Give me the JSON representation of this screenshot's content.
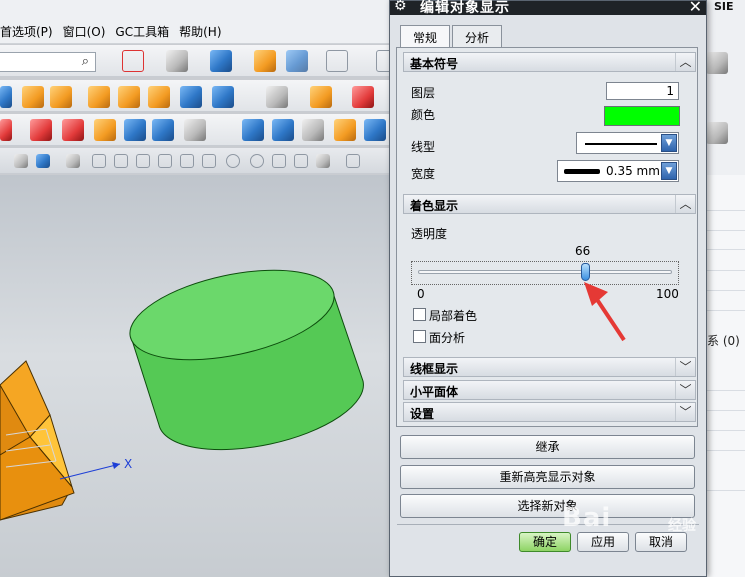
{
  "menubar": {
    "items": [
      "首选项(P)",
      "窗口(O)",
      "GC工具箱",
      "帮助(H)"
    ]
  },
  "app": {
    "brand_partial": "SIE",
    "right_panel_text": "系 (0)"
  },
  "viewport": {
    "axis_label": "X",
    "colors": {
      "cylinder": "#5ccf5c",
      "block": "#e8900e",
      "background": "#c9ced3"
    }
  },
  "dialog": {
    "title": "编辑对象显示",
    "tabs": [
      {
        "label": "常规",
        "active": true
      },
      {
        "label": "分析",
        "active": false
      }
    ],
    "sections": {
      "basic": {
        "title": "基本符号",
        "layer_label": "图层",
        "layer_value": "1",
        "color_label": "颜色",
        "color_value": "#00ff00",
        "linetype_label": "线型",
        "width_label": "宽度",
        "width_value": "0.35 mm"
      },
      "shading": {
        "title": "着色显示",
        "transparency_label": "透明度",
        "transparency_value": "66",
        "slider_min": "0",
        "slider_max": "100",
        "partial_shading_label": "局部着色",
        "face_analysis_label": "面分析"
      },
      "wireframe": {
        "title": "线框显示"
      },
      "facet": {
        "title": "小平面体"
      },
      "settings": {
        "title": "设置"
      }
    },
    "buttons": {
      "inherit": "继承",
      "rehighlight": "重新高亮显示对象",
      "select_new": "选择新对象",
      "ok": "确定",
      "apply": "应用",
      "cancel": "取消"
    }
  },
  "watermark": {
    "main": "Bai",
    "sub": "经验"
  }
}
